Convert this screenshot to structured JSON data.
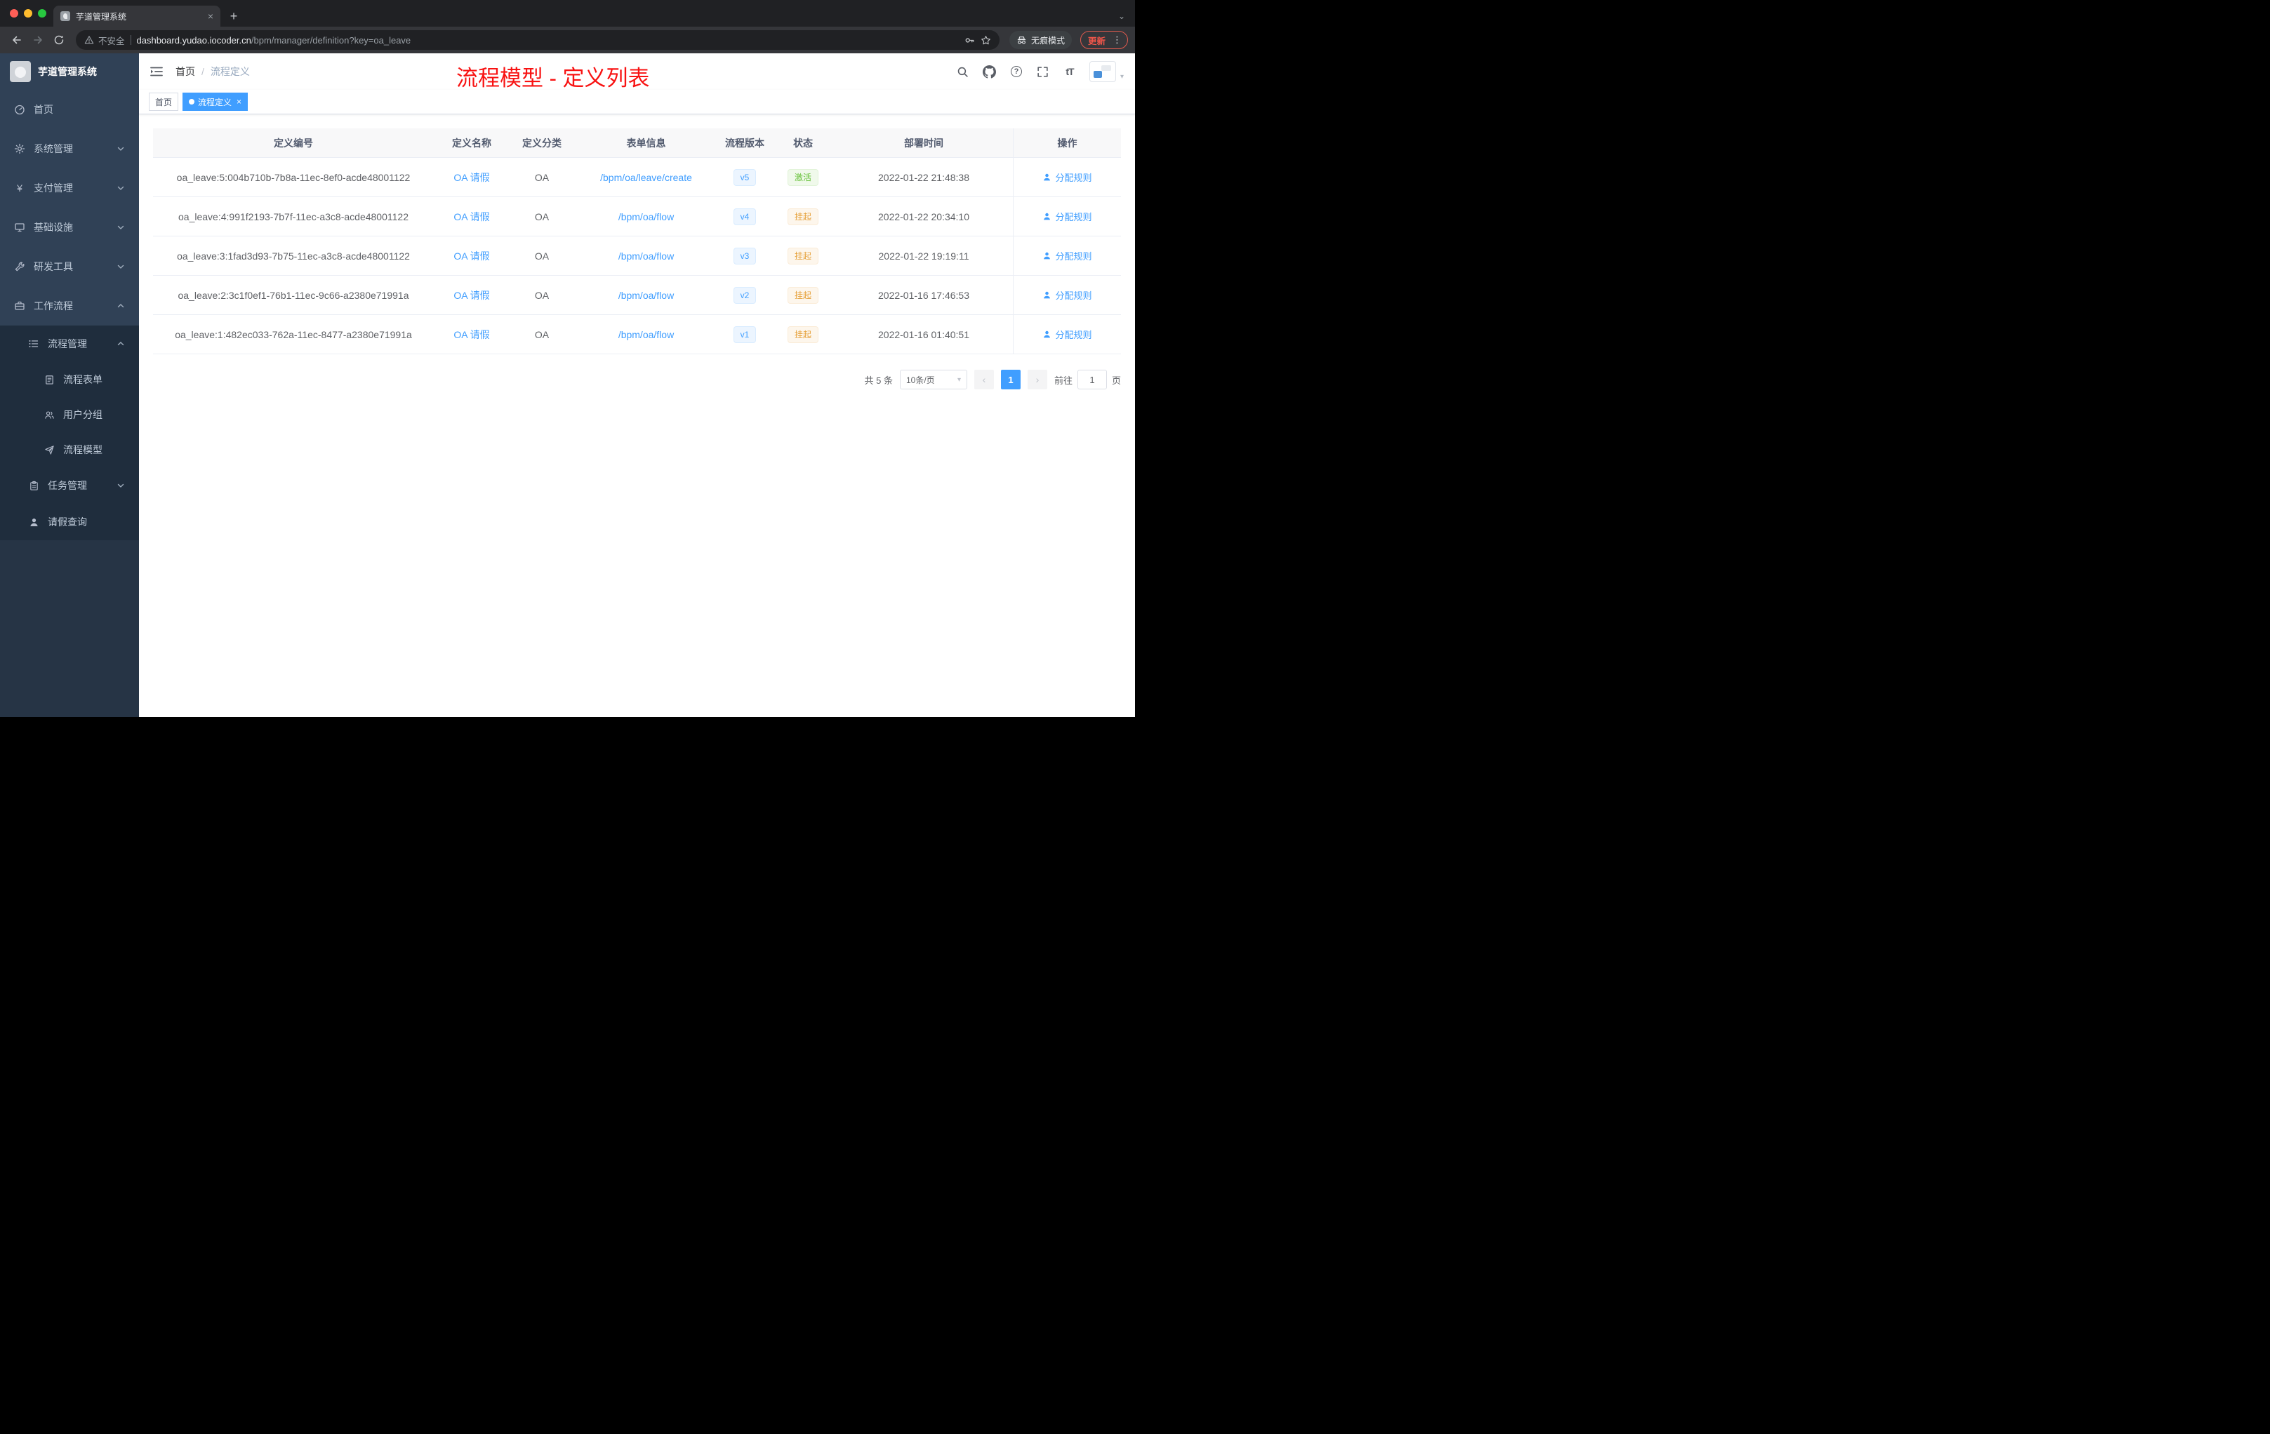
{
  "colors": {
    "accent": "#409eff",
    "success": "#67c23a",
    "warning": "#e6a23c",
    "annotation_red": "#f81212",
    "sidebar_bg": "#304156",
    "sidebar_sub_bg": "#1f2d3d"
  },
  "glyphs": {
    "close": "×",
    "add_tab": "+",
    "kebab": "⋮",
    "caret_down": "▾",
    "prev": "‹",
    "next": "›",
    "yen": "¥",
    "font_size": "tT",
    "help": "?",
    "slash": "/",
    "tab_search": "⌄"
  },
  "browser": {
    "tab": {
      "title": "芋道管理系统"
    },
    "address": {
      "security_label": "不安全",
      "url_host": "dashboard.yudao.iocoder.cn",
      "url_path": "/bpm/manager/definition?key=oa_leave",
      "incognito_label": "无痕模式",
      "update_label": "更新"
    }
  },
  "sidebar": {
    "app_title": "芋道管理系统",
    "items": [
      {
        "label": "首页",
        "icon": "dashboard-icon",
        "level": 1
      },
      {
        "label": "系统管理",
        "icon": "gear-icon",
        "level": 1,
        "state": "collapsed"
      },
      {
        "label": "支付管理",
        "icon": "yen-icon",
        "level": 1,
        "state": "collapsed"
      },
      {
        "label": "基础设施",
        "icon": "monitor-icon",
        "level": 1,
        "state": "collapsed"
      },
      {
        "label": "研发工具",
        "icon": "tool-icon",
        "level": 1,
        "state": "collapsed"
      },
      {
        "label": "工作流程",
        "icon": "briefcase-icon",
        "level": 1,
        "state": "expanded"
      },
      {
        "label": "流程管理",
        "icon": "list-icon",
        "level": 2,
        "state": "expanded"
      },
      {
        "label": "流程表单",
        "icon": "form-icon",
        "level": 3
      },
      {
        "label": "用户分组",
        "icon": "users-icon",
        "level": 3
      },
      {
        "label": "流程模型",
        "icon": "send-icon",
        "level": 3
      },
      {
        "label": "任务管理",
        "icon": "clipboard-icon",
        "level": 2,
        "state": "collapsed"
      },
      {
        "label": "请假查询",
        "icon": "person-icon",
        "level": 2
      }
    ]
  },
  "header": {
    "breadcrumb_home": "首页",
    "breadcrumb_current": "流程定义",
    "annotation": "流程模型 - 定义列表"
  },
  "tags": {
    "home": "首页",
    "active": "流程定义"
  },
  "table": {
    "columns": [
      "定义编号",
      "定义名称",
      "定义分类",
      "表单信息",
      "流程版本",
      "状态",
      "部署时间",
      "操作"
    ],
    "rows": [
      {
        "id": "oa_leave:5:004b710b-7b8a-11ec-8ef0-acde48001122",
        "name": "OA 请假",
        "category": "OA",
        "form": "/bpm/oa/leave/create",
        "version": "v5",
        "status": "激活",
        "status_type": "success",
        "deployed_at": "2022-01-22 21:48:38",
        "action": "分配规则"
      },
      {
        "id": "oa_leave:4:991f2193-7b7f-11ec-a3c8-acde48001122",
        "name": "OA 请假",
        "category": "OA",
        "form": "/bpm/oa/flow",
        "version": "v4",
        "status": "挂起",
        "status_type": "warning",
        "deployed_at": "2022-01-22 20:34:10",
        "action": "分配规则"
      },
      {
        "id": "oa_leave:3:1fad3d93-7b75-11ec-a3c8-acde48001122",
        "name": "OA 请假",
        "category": "OA",
        "form": "/bpm/oa/flow",
        "version": "v3",
        "status": "挂起",
        "status_type": "warning",
        "deployed_at": "2022-01-22 19:19:11",
        "action": "分配规则"
      },
      {
        "id": "oa_leave:2:3c1f0ef1-76b1-11ec-9c66-a2380e71991a",
        "name": "OA 请假",
        "category": "OA",
        "form": "/bpm/oa/flow",
        "version": "v2",
        "status": "挂起",
        "status_type": "warning",
        "deployed_at": "2022-01-16 17:46:53",
        "action": "分配规则"
      },
      {
        "id": "oa_leave:1:482ec033-762a-11ec-8477-a2380e71991a",
        "name": "OA 请假",
        "category": "OA",
        "form": "/bpm/oa/flow",
        "version": "v1",
        "status": "挂起",
        "status_type": "warning",
        "deployed_at": "2022-01-16 01:40:51",
        "action": "分配规则"
      }
    ]
  },
  "pagination": {
    "total": "共 5 条",
    "page_size": "10条/页",
    "current_page": "1",
    "goto_label": "前往",
    "goto_value": "1",
    "goto_unit": "页"
  }
}
